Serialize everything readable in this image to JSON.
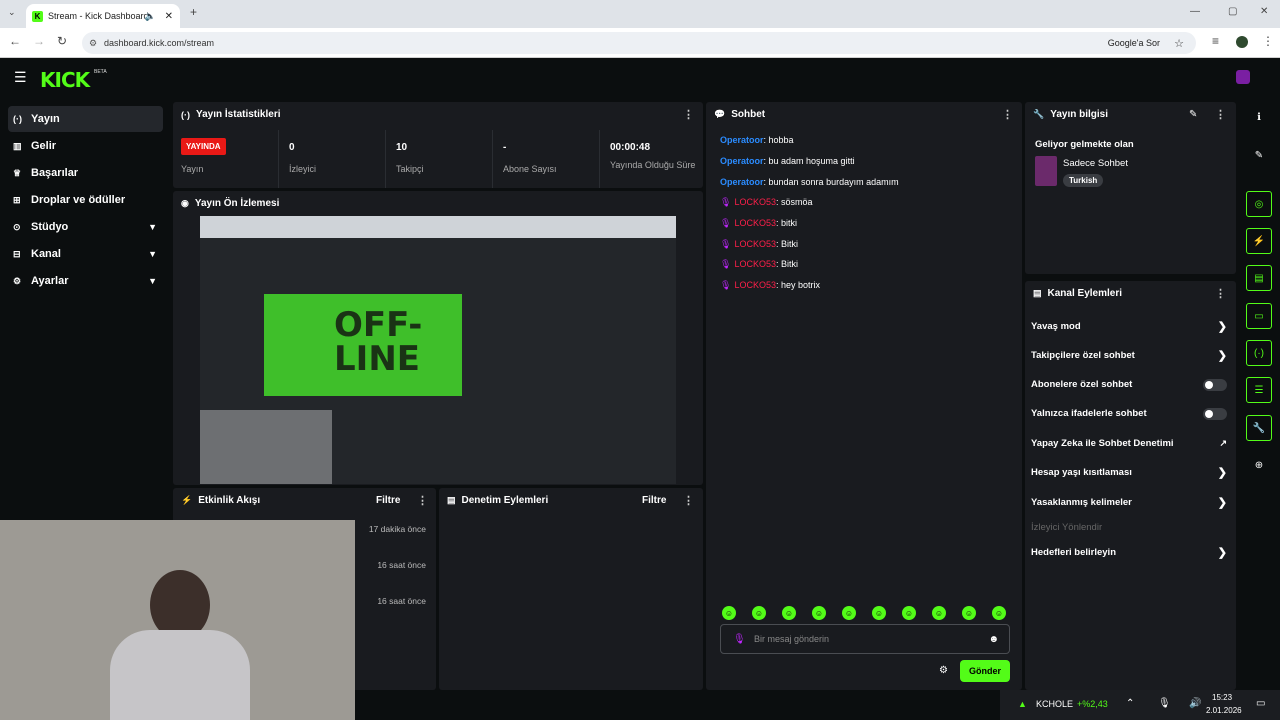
{
  "browser": {
    "tab_title": "Stream - Kick Dashboard",
    "url": "dashboard.kick.com/stream",
    "google_btn": "Google'a Sor"
  },
  "header": {
    "logo": "KICK",
    "beta": "BETA"
  },
  "sidebar": {
    "items": [
      {
        "label": "Yayın",
        "icon": "broadcast-icon"
      },
      {
        "label": "Gelir",
        "icon": "revenue-icon"
      },
      {
        "label": "Başarılar",
        "icon": "trophy-icon"
      },
      {
        "label": "Droplar ve ödüller",
        "icon": "drops-icon"
      },
      {
        "label": "Stüdyo",
        "icon": "studio-icon"
      },
      {
        "label": "Kanal",
        "icon": "channel-icon"
      },
      {
        "label": "Ayarlar",
        "icon": "settings-icon"
      }
    ]
  },
  "stats": {
    "title": "Yayın İstatistikleri",
    "live_badge": "YAYINDA",
    "items": [
      {
        "value": "",
        "label": "Yayın"
      },
      {
        "value": "0",
        "label": "İzleyici"
      },
      {
        "value": "10",
        "label": "Takipçi"
      },
      {
        "value": "-",
        "label": "Abone Sayısı"
      },
      {
        "value": "00:00:48",
        "label": "Yayında Olduğu Süre"
      }
    ]
  },
  "preview": {
    "title": "Yayın Ön İzlemesi"
  },
  "activity": {
    "title": "Etkinlik Akışı",
    "filter": "Filtre",
    "events": [
      "17 dakika önce",
      "16 saat önce",
      "16 saat önce"
    ]
  },
  "moderation": {
    "title": "Denetim Eylemleri",
    "filter": "Filtre"
  },
  "chat": {
    "title": "Sohbet",
    "messages": [
      {
        "user": "Operatoor",
        "text": ": hobba",
        "type": "op"
      },
      {
        "user": "Operatoor",
        "text": ": bu adam hoşuma gitti",
        "type": "op"
      },
      {
        "user": "Operatoor",
        "text": ": bundan sonra burdayım adamım",
        "type": "op"
      },
      {
        "user": "LOCKO53",
        "text": ": sösmöa",
        "type": "lo"
      },
      {
        "user": "LOCKO53",
        "text": ": bitki",
        "type": "lo"
      },
      {
        "user": "LOCKO53",
        "text": ": Bitki",
        "type": "lo"
      },
      {
        "user": "LOCKO53",
        "text": ": Bitki",
        "type": "lo"
      },
      {
        "user": "LOCKO53",
        "text": ": hey botrix",
        "type": "lo"
      }
    ],
    "placeholder": "Bir mesaj gönderin",
    "send": "Gönder"
  },
  "info": {
    "title": "Yayın bilgisi",
    "stream_title": "Geliyor gelmekte olan",
    "category": "Sadece Sohbet",
    "tag": "Turkish"
  },
  "actions": {
    "title": "Kanal Eylemleri",
    "items": [
      {
        "label": "Yavaş mod",
        "kind": "chev"
      },
      {
        "label": "Takipçilere özel sohbet",
        "kind": "chev"
      },
      {
        "label": "Abonelere özel sohbet",
        "kind": "toggle"
      },
      {
        "label": "Yalnızca ifadelerle sohbet",
        "kind": "toggle"
      },
      {
        "label": "Yapay Zeka ile Sohbet Denetimi",
        "kind": "ext"
      },
      {
        "label": "Hesap yaşı kısıtlaması",
        "kind": "chev"
      },
      {
        "label": "Yasaklanmış kelimeler",
        "kind": "chev"
      },
      {
        "label": "İzleyici Yönlendir",
        "kind": "dim"
      },
      {
        "label": "Hedefleri belirleyin",
        "kind": "chev"
      }
    ]
  },
  "taskbar": {
    "ticker": "KCHOLE",
    "change": "+%2,43",
    "time": "15:23",
    "date": "2.01.2026"
  },
  "colors": {
    "accent": "#53fc18",
    "live": "#e91916",
    "operator": "#2b8cff",
    "locko": "#ff1f4a"
  }
}
